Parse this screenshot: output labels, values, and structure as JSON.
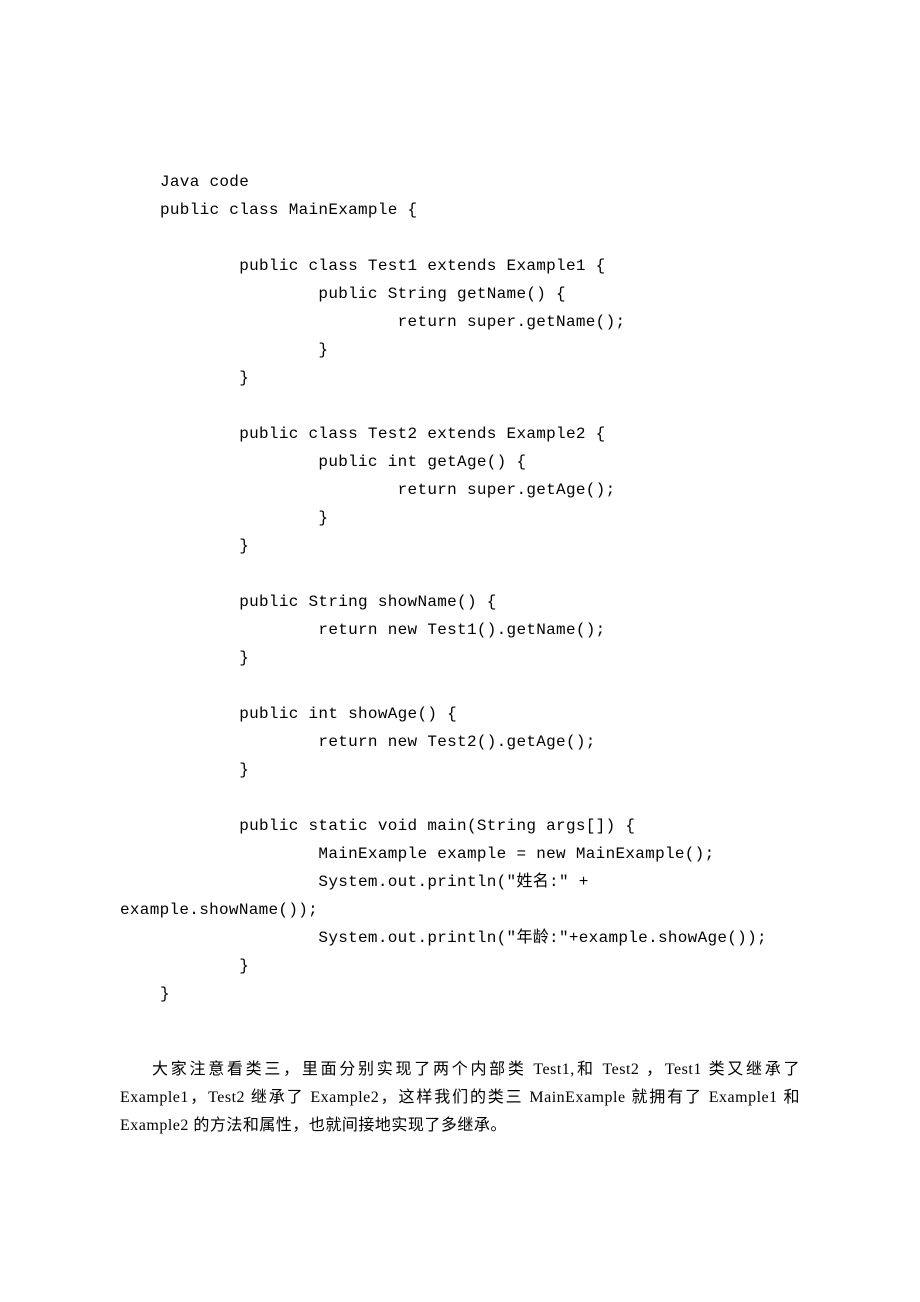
{
  "code": {
    "line01": "Java code",
    "line02": "public class MainExample {",
    "line03": "",
    "line04": "        public class Test1 extends Example1 {",
    "line05": "                public String getName() {",
    "line06": "                        return super.getName();",
    "line07": "                }",
    "line08": "        }",
    "line09": "",
    "line10": "        public class Test2 extends Example2 {",
    "line11": "                public int getAge() {",
    "line12": "                        return super.getAge();",
    "line13": "                }",
    "line14": "        }",
    "line15": "",
    "line16": "        public String showName() {",
    "line17": "                return new Test1().getName();",
    "line18": "        }",
    "line19": "",
    "line20": "        public int showAge() {",
    "line21": "                return new Test2().getAge();",
    "line22": "        }",
    "line23": "",
    "line24": "        public static void main(String args[]) {",
    "line25": "                MainExample example = new MainExample();",
    "line26": "                System.out.println(\"姓名:\" +",
    "line27": "example.showName());",
    "line28": "                System.out.println(\"年龄:\"+example.showAge());",
    "line29": "        }",
    "line30": "}"
  },
  "paragraph": "大家注意看类三，里面分别实现了两个内部类 Test1,和 Test2 ，Test1 类又继承了 Example1，Test2 继承了 Example2，这样我们的类三 MainExample 就拥有了 Example1 和 Example2 的方法和属性，也就间接地实现了多继承。"
}
